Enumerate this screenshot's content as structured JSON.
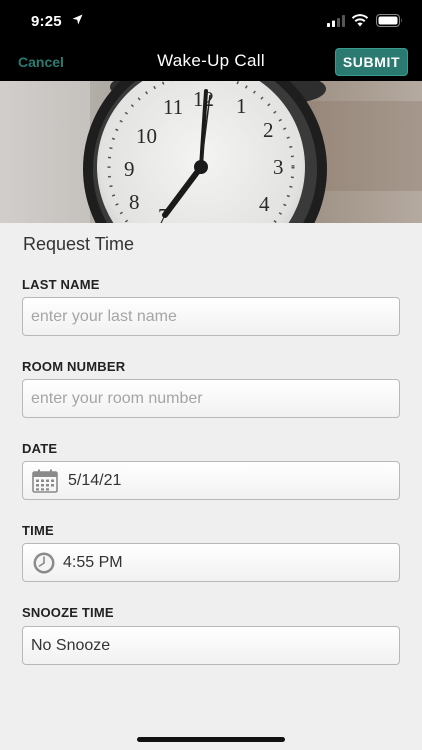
{
  "status_bar": {
    "time": "9:25"
  },
  "nav": {
    "cancel_label": "Cancel",
    "title": "Wake-Up Call",
    "submit_label": "SUBMIT"
  },
  "form": {
    "section_title": "Request Time",
    "last_name": {
      "label": "LAST NAME",
      "placeholder": "enter your last name"
    },
    "room_number": {
      "label": "ROOM NUMBER",
      "placeholder": "enter your room number"
    },
    "date": {
      "label": "DATE",
      "value": "5/14/21",
      "icon": "calendar-icon"
    },
    "time": {
      "label": "TIME",
      "value": "4:55 PM",
      "icon": "clock-icon"
    },
    "snooze": {
      "label": "SNOOZE TIME",
      "value": "No Snooze"
    }
  },
  "colors": {
    "accent": "#2b7a72",
    "nav_background": "#000000",
    "page_background": "#efefef"
  }
}
